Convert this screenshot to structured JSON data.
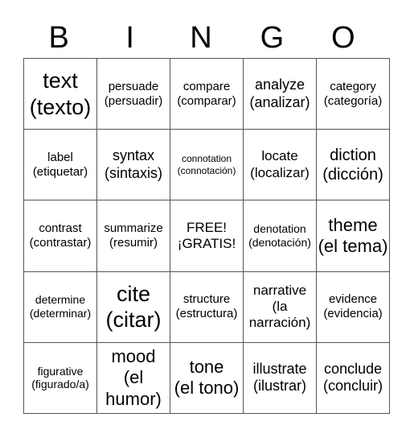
{
  "header": {
    "letters": [
      "B",
      "I",
      "N",
      "G",
      "O"
    ]
  },
  "card": {
    "rows": [
      [
        {
          "en": "text",
          "es": "(texto)",
          "size": "s27"
        },
        {
          "en": "persuade",
          "es": "(persuadir)",
          "size": "s15"
        },
        {
          "en": "compare",
          "es": "(comparar)",
          "size": "s15"
        },
        {
          "en": "analyze",
          "es": "(analizar)",
          "size": "s18"
        },
        {
          "en": "category",
          "es": "(categoría)",
          "size": "s15"
        }
      ],
      [
        {
          "en": "label",
          "es": "(etiquetar)",
          "size": "s15"
        },
        {
          "en": "syntax",
          "es": "(sintaxis)",
          "size": "s18"
        },
        {
          "en": "connotation",
          "es": "(connotación)",
          "size": "s12"
        },
        {
          "en": "locate",
          "es": "(localizar)",
          "size": "s17"
        },
        {
          "en": "diction",
          "es": "(dicción)",
          "size": "s20"
        }
      ],
      [
        {
          "en": "contrast",
          "es": "(contrastar)",
          "size": "s15"
        },
        {
          "en": "summarize",
          "es": "(resumir)",
          "size": "s15"
        },
        {
          "en": "FREE!",
          "es": "¡GRATIS!",
          "size": "s17"
        },
        {
          "en": "denotation",
          "es": "(denotación)",
          "size": "s14"
        },
        {
          "en": "theme",
          "es": "(el tema)",
          "size": "s22"
        }
      ],
      [
        {
          "en": "determine",
          "es": "(determinar)",
          "size": "s14"
        },
        {
          "en": "cite",
          "es": "(citar)",
          "size": "s27"
        },
        {
          "en": "structure",
          "es": "(estructura)",
          "size": "s15"
        },
        {
          "en": "narrative",
          "es": "(la narración)",
          "size": "s17"
        },
        {
          "en": "evidence",
          "es": "(evidencia)",
          "size": "s15"
        }
      ],
      [
        {
          "en": "figurative",
          "es": "(figurado/a)",
          "size": "s14"
        },
        {
          "en": "mood",
          "es": "(el humor)",
          "size": "s22"
        },
        {
          "en": "tone",
          "es": "(el tono)",
          "size": "s22"
        },
        {
          "en": "illustrate",
          "es": "(ilustrar)",
          "size": "s18"
        },
        {
          "en": "conclude",
          "es": "(concluir)",
          "size": "s18"
        }
      ]
    ]
  }
}
